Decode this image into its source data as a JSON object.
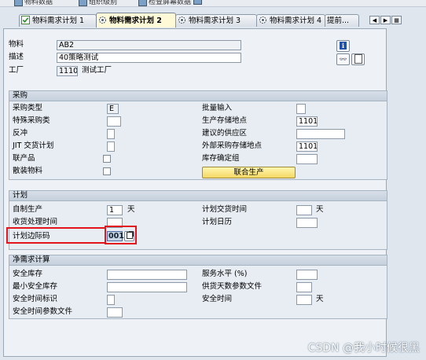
{
  "toolbar": {
    "items": [
      {
        "label": "物料数据"
      },
      {
        "label": "组织级别"
      },
      {
        "label": "检查屏幕数据"
      }
    ]
  },
  "tabs": [
    {
      "label": "物料需求计划 1"
    },
    {
      "label": "物料需求计划 2"
    },
    {
      "label": "物料需求计划 3"
    },
    {
      "label": "物料需求计划 4"
    },
    {
      "label": "提前..."
    }
  ],
  "active_tab": "物料需求计划 2",
  "header": {
    "material_label": "物料",
    "material_value": "AB2",
    "desc_label": "描述",
    "desc_value": "40策略测试",
    "plant_label": "工厂",
    "plant_value": "1110",
    "plant_name": "测试工厂"
  },
  "procurement": {
    "title": "采购",
    "proc_type_label": "采购类型",
    "proc_type_value": "E",
    "special_proc_label": "特殊采购类",
    "backflush_label": "反冲",
    "jit_label": "JIT 交货计划",
    "coproduct_label": "联产品",
    "bulk_label": "散装物料",
    "batch_entry_label": "批量输入",
    "prod_storage_label": "生产存储地点",
    "prod_storage_value": "1101",
    "proposed_supply_label": "建议的供应区",
    "ext_storage_label": "外部采购存储地点",
    "ext_storage_value": "1101",
    "storage_det_label": "库存确定组",
    "joint_prod_button": "联合生产"
  },
  "scheduling": {
    "title": "计划",
    "inhouse_label": "自制生产",
    "inhouse_value": "1",
    "inhouse_unit": "天",
    "gr_time_label": "收货处理时间",
    "sm_key_label": "计划边际码",
    "sm_key_value": "001",
    "plan_deliv_label": "计划交货时间",
    "plan_deliv_unit": "天",
    "plan_cal_label": "计划日历"
  },
  "net_req": {
    "title": "净需求计算",
    "safety_stock_label": "安全库存",
    "min_safety_label": "最小安全库存",
    "safety_time_ind_label": "安全时间标识",
    "safety_time_prof_label": "安全时间参数文件",
    "service_level_label": "服务水平 (%)",
    "cov_profile_label": "供货天数参数文件",
    "safety_time_label": "安全时间",
    "safety_time_unit": "天"
  },
  "watermark": "CSDN @我小时候很黑"
}
